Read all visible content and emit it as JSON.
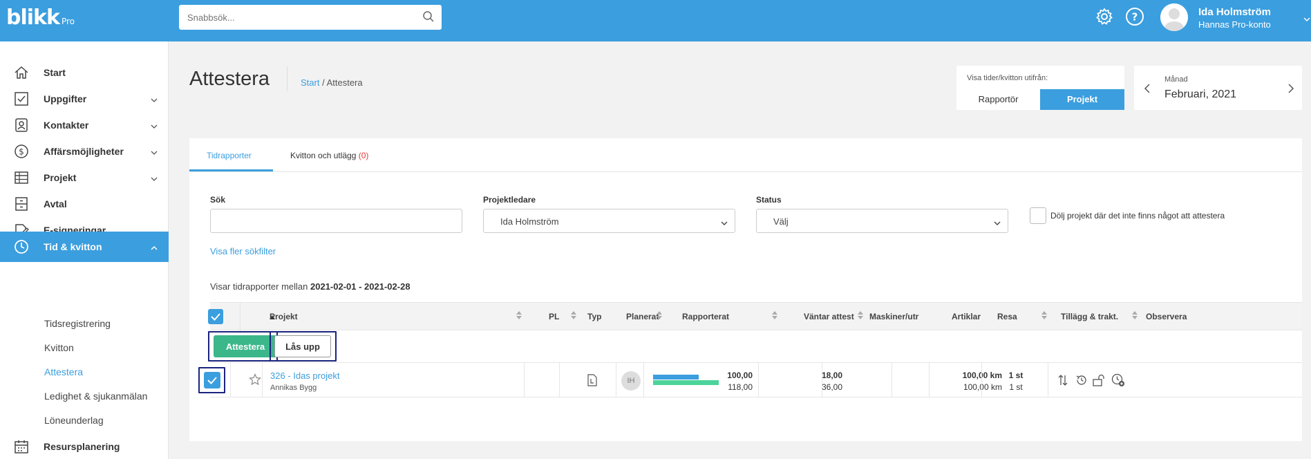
{
  "header": {
    "logo": "blikk",
    "logo_sub": "Pro",
    "search_placeholder": "Snabbsök...",
    "user_name": "Ida Holmström",
    "user_account": "Hannas Pro-konto"
  },
  "sidebar": {
    "items": [
      {
        "label": "Start",
        "icon": "home-icon"
      },
      {
        "label": "Uppgifter",
        "icon": "checkbox-icon"
      },
      {
        "label": "Kontakter",
        "icon": "contact-card-icon"
      },
      {
        "label": "Affärsmöjligheter",
        "icon": "dollar-icon"
      },
      {
        "label": "Projekt",
        "icon": "table-icon"
      },
      {
        "label": "Avtal",
        "icon": "cabinet-icon"
      },
      {
        "label": "E-signeringar",
        "icon": "signature-icon"
      },
      {
        "label": "Tid & kvitton",
        "icon": "clock-icon"
      },
      {
        "label": "Resursplanering",
        "icon": "calendar-icon"
      }
    ],
    "subitems": [
      "Tidsregistrering",
      "Kvitton",
      "Attestera",
      "Ledighet & sjukanmälan",
      "Löneunderlag"
    ]
  },
  "page": {
    "title": "Attestera",
    "breadcrumb_home": "Start",
    "breadcrumb_sep": " / ",
    "breadcrumb_current": "Attestera"
  },
  "view_toggle": {
    "label": "Visa tider/kvitton utifrån:",
    "options": [
      "Rapportör",
      "Projekt"
    ],
    "selected": "Projekt"
  },
  "month": {
    "label": "Månad",
    "value": "Februari, 2021"
  },
  "tabs": {
    "t1": "Tidrapporter",
    "t2": "Kvitton och utlägg",
    "t2_count": "(0)"
  },
  "filters": {
    "search_label": "Sök",
    "search_value": "",
    "pl_label": "Projektledare",
    "pl_value": "Ida Holmström",
    "status_label": "Status",
    "status_value": "Välj",
    "hide_label": "Dölj projekt där det inte finns något att attestera",
    "more_filters": "Visa fler sökfilter"
  },
  "range": {
    "prefix": "Visar tidrapporter mellan ",
    "value": "2021-02-01 - 2021-02-28"
  },
  "table": {
    "columns": [
      "Projekt",
      "PL",
      "Typ",
      "Planerat",
      "Rapporterat",
      "Väntar attest",
      "Maskiner/utr",
      "Artiklar",
      "Resa",
      "Tillägg & trakt.",
      "Observera"
    ],
    "btn_attest": "Attestera",
    "btn_unlock": "Lås upp",
    "rows": [
      {
        "project": "326 - Idas projekt",
        "customer": "Annikas Bygg",
        "pl": "IH",
        "reported_a": "100,00",
        "reported_b": "118,00",
        "reported_bar_a": 100,
        "reported_bar_b": 118,
        "waiting_a": "18,00",
        "waiting_b": "36,00",
        "travel_a": "100,00 km",
        "travel_b": "100,00 km",
        "extra_a": "1 st",
        "extra_b": "1 st"
      }
    ]
  },
  "colors": {
    "accent": "#3b9ede",
    "green": "#3bb78a",
    "bar_green": "#4cd49a",
    "red": "#e53935"
  }
}
